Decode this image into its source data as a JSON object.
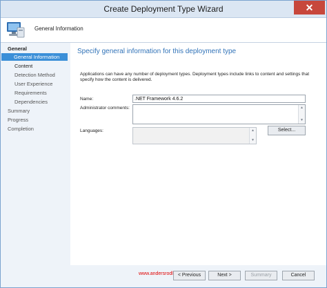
{
  "window": {
    "title": "Create Deployment Type Wizard",
    "close_glyph": "✕"
  },
  "header": {
    "icon": "computer-icon",
    "text": "General Information"
  },
  "nav": {
    "items": [
      {
        "label": "General"
      },
      {
        "label": "General Information"
      },
      {
        "label": "Content"
      },
      {
        "label": "Detection Method"
      },
      {
        "label": "User Experience"
      },
      {
        "label": "Requirements"
      },
      {
        "label": "Dependencies"
      },
      {
        "label": "Summary"
      },
      {
        "label": "Progress"
      },
      {
        "label": "Completion"
      }
    ]
  },
  "content": {
    "heading": "Specify general information for this deployment type",
    "description": "Applications can have any number of deployment types. Deployment types include links to content and settings that specify how the content is delivered.",
    "name_label": "Name:",
    "name_value": ".NET Framework 4.6.2",
    "admin_comments_label": "Administrator comments:",
    "admin_comments_value": "",
    "languages_label": "Languages:",
    "select_button": "Select..."
  },
  "footer": {
    "watermark": "www.andersrodland.com",
    "previous": "< Previous",
    "next": "Next >",
    "summary": "Summary",
    "cancel": "Cancel"
  },
  "colors": {
    "accent": "#3173b8",
    "selected_nav": "#3b8fd8",
    "watermark": "#e00000"
  }
}
